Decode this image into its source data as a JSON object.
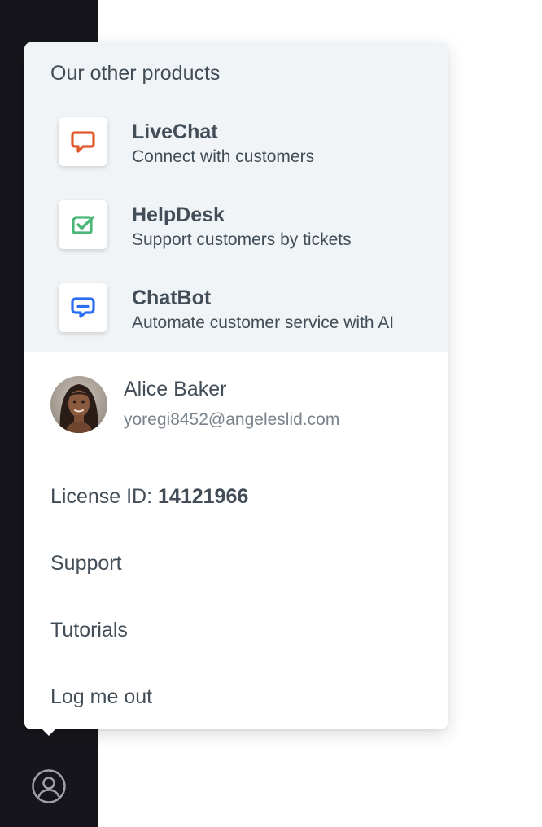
{
  "products": {
    "heading": "Our other products",
    "items": [
      {
        "name": "LiveChat",
        "description": "Connect with customers",
        "icon": "livechat-icon",
        "color": "#e0592a"
      },
      {
        "name": "HelpDesk",
        "description": "Support customers by tickets",
        "icon": "helpdesk-icon",
        "color": "#4ab779"
      },
      {
        "name": "ChatBot",
        "description": "Automate customer service with AI",
        "icon": "chatbot-icon",
        "color": "#2c6ef2"
      }
    ]
  },
  "user": {
    "name": "Alice Baker",
    "email": "yoregi8452@angeleslid.com"
  },
  "license": {
    "label": "License ID: ",
    "id": "14121966"
  },
  "menu": {
    "support": "Support",
    "tutorials": "Tutorials",
    "logout": "Log me out"
  },
  "sidebar": {
    "account_icon": "user-circle-icon"
  }
}
